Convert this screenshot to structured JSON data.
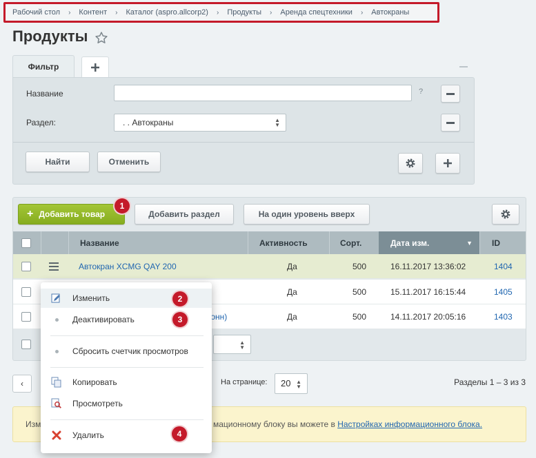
{
  "breadcrumb": [
    "Рабочий стол",
    "Контент",
    "Каталог (aspro.allcorp2)",
    "Продукты",
    "Аренда спецтехники",
    "Автокраны"
  ],
  "page": {
    "title": "Продукты"
  },
  "filter": {
    "tab_label": "Фильтр",
    "add_tab": "+",
    "name_label": "Название",
    "name_value": "",
    "help": "?",
    "section_label": "Раздел:",
    "section_value": ". . Автокраны",
    "find_button": "Найти",
    "cancel_button": "Отменить"
  },
  "toolbar": {
    "add_product": "Добавить товар",
    "add_section": "Добавить раздел",
    "level_up": "На один уровень вверх"
  },
  "table": {
    "headers": {
      "name": "Название",
      "active": "Активность",
      "sort": "Сорт.",
      "date": "Дата изм.",
      "id": "ID"
    },
    "rows": [
      {
        "name": "Автокран XCMG QAY 200",
        "active": "Да",
        "sort": "500",
        "date": "16.11.2017 13:36:02",
        "id": "1404"
      },
      {
        "name": "",
        "active": "Да",
        "sort": "500",
        "date": "15.11.2017 16:15:44",
        "id": "1405"
      },
      {
        "name": "тонн)",
        "active": "Да",
        "sort": "500",
        "date": "14.11.2017 20:05:16",
        "id": "1403"
      }
    ]
  },
  "context_menu": {
    "edit": "Изменить",
    "deactivate": "Деактивировать",
    "reset_views": "Сбросить счетчик просмотров",
    "copy": "Копировать",
    "view": "Просмотреть",
    "delete": "Удалить"
  },
  "badges": [
    "1",
    "2",
    "3",
    "4"
  ],
  "pagination": {
    "prev": "‹",
    "per_page_label": "На странице:",
    "per_page_value": "20",
    "summary": "Разделы 1 – 3 из 3"
  },
  "notice": {
    "left_text": "Изм",
    "mid_text": "мационному блоку вы можете в ",
    "link_text": "Настройках информационного блока."
  },
  "colors": {
    "accent_green": "#8bb524",
    "badge_red": "#c41a2a",
    "link_blue": "#2066b0"
  }
}
